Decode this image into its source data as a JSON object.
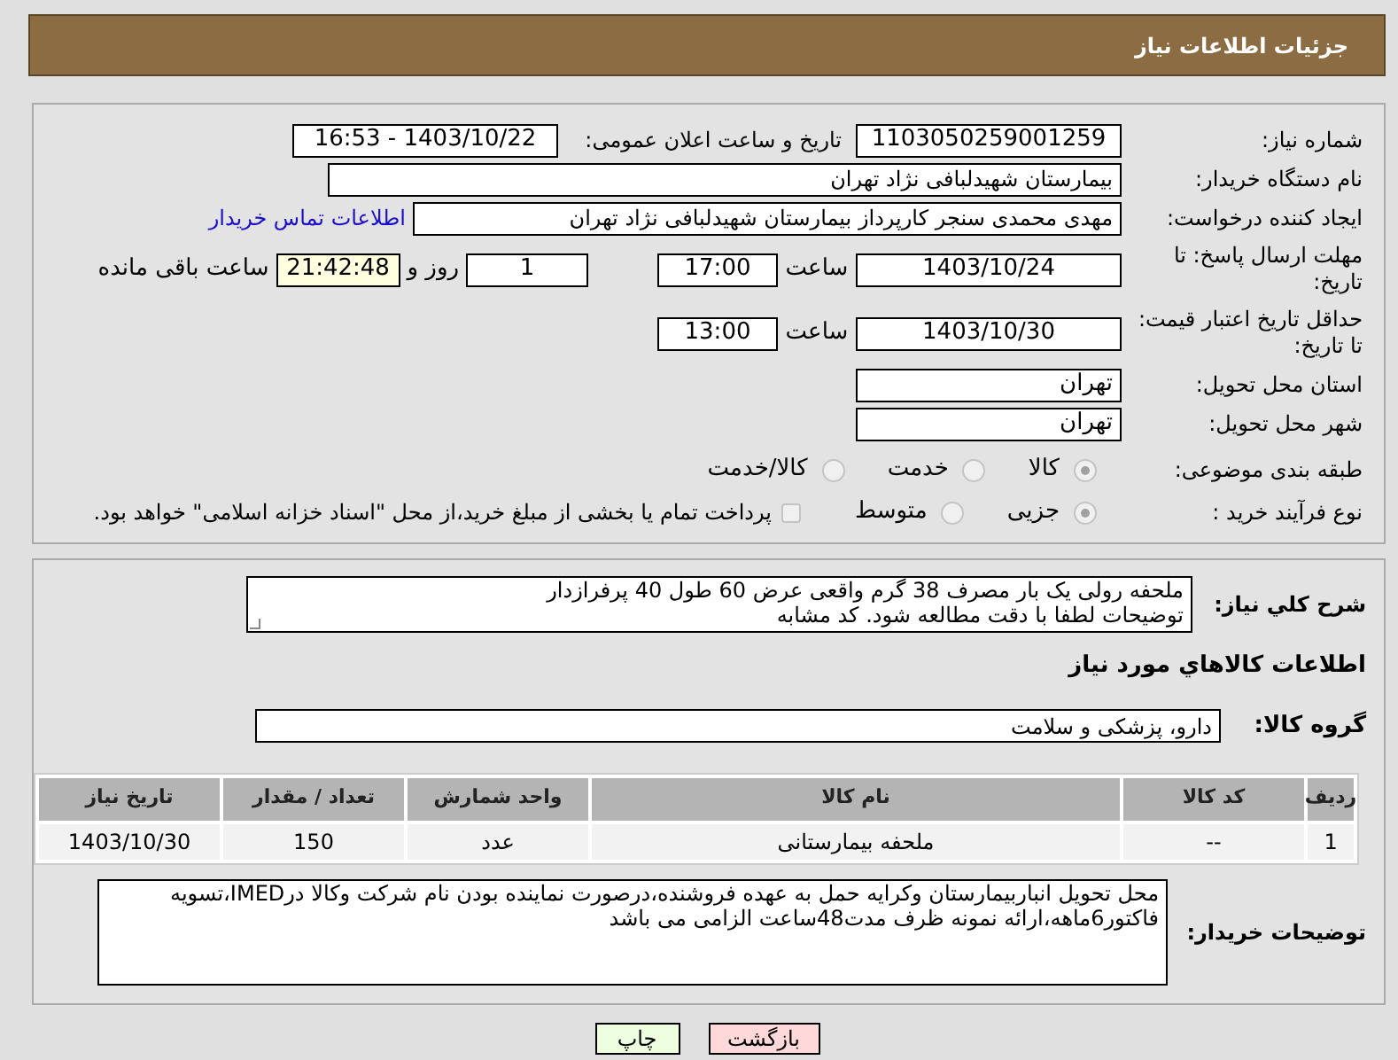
{
  "header": {
    "title": "جزئیات اطلاعات نیاز"
  },
  "need_number": {
    "label": "شماره نیاز:",
    "value": "1103050259001259"
  },
  "announce": {
    "label": "تاریخ و ساعت اعلان عمومی:",
    "value": "1403/10/22 - 16:53"
  },
  "buyer": {
    "label": "نام دستگاه خریدار:",
    "value": "بیمارستان شهیدلبافی نژاد تهران"
  },
  "requester": {
    "label": "ایجاد کننده درخواست:",
    "value": "مهدی محمدی سنجر کارپرداز بیمارستان شهیدلبافی نژاد تهران",
    "link": "اطلاعات تماس خریدار"
  },
  "response_deadline": {
    "label": "مهلت ارسال پاسخ: تا تاریخ:",
    "date": "1403/10/24",
    "time_label": "ساعت",
    "time": "17:00",
    "days": "1",
    "days_label": "روز و",
    "remaining": "21:42:48",
    "remaining_label": "ساعت باقی مانده"
  },
  "price_validity": {
    "label": "حداقل تاریخ اعتبار قیمت: تا تاریخ:",
    "date": "1403/10/30",
    "time_label": "ساعت",
    "time": "13:00"
  },
  "province": {
    "label": "استان محل تحویل:",
    "value": "تهران"
  },
  "city": {
    "label": "شهر محل تحویل:",
    "value": "تهران"
  },
  "category": {
    "label": "طبقه بندی موضوعی:",
    "options": [
      {
        "label": "کالا",
        "selected": true
      },
      {
        "label": "خدمت",
        "selected": false
      },
      {
        "label": "کالا/خدمت",
        "selected": false
      }
    ]
  },
  "process": {
    "label": "نوع فرآیند خرید :",
    "options": [
      {
        "label": "جزیی",
        "selected": true
      },
      {
        "label": "متوسط",
        "selected": false
      }
    ],
    "payment": {
      "label": "پرداخت تمام یا بخشی از مبلغ خرید،از محل \"اسناد خزانه اسلامی\" خواهد بود.",
      "checked": false
    }
  },
  "description": {
    "label": "شرح کلي نياز:",
    "text": "ملحفه رولی یک بار مصرف 38 گرم واقعی عرض 60 طول 40 پرفرازدار\nتوضیحات لطفا با دقت مطالعه شود. کد مشابه"
  },
  "goods_title": "اطلاعات کالاهاي مورد نياز",
  "group": {
    "label": "گروه کالا:",
    "value": "دارو، پزشکی و سلامت"
  },
  "table": {
    "columns": [
      "ردیف",
      "کد کالا",
      "نام کالا",
      "واحد شمارش",
      "تعداد / مقدار",
      "تاریخ نیاز"
    ],
    "rows": [
      [
        "1",
        "--",
        "ملحفه بیمارستانی",
        "عدد",
        "150",
        "1403/10/30"
      ]
    ]
  },
  "buyer_notes": {
    "label": "توضیحات خریدار:",
    "text": "محل تحویل انباربیمارستان وکرایه حمل به عهده فروشنده،درصورت نماینده بودن نام شرکت وکالا درIMED،تسویه فاکتور6ماهه،ارائه نمونه ظرف مدت48ساعت الزامی می باشد"
  },
  "buttons": [
    {
      "label": "بازگشت",
      "kind": "back"
    },
    {
      "label": "چاپ",
      "kind": "print"
    }
  ]
}
